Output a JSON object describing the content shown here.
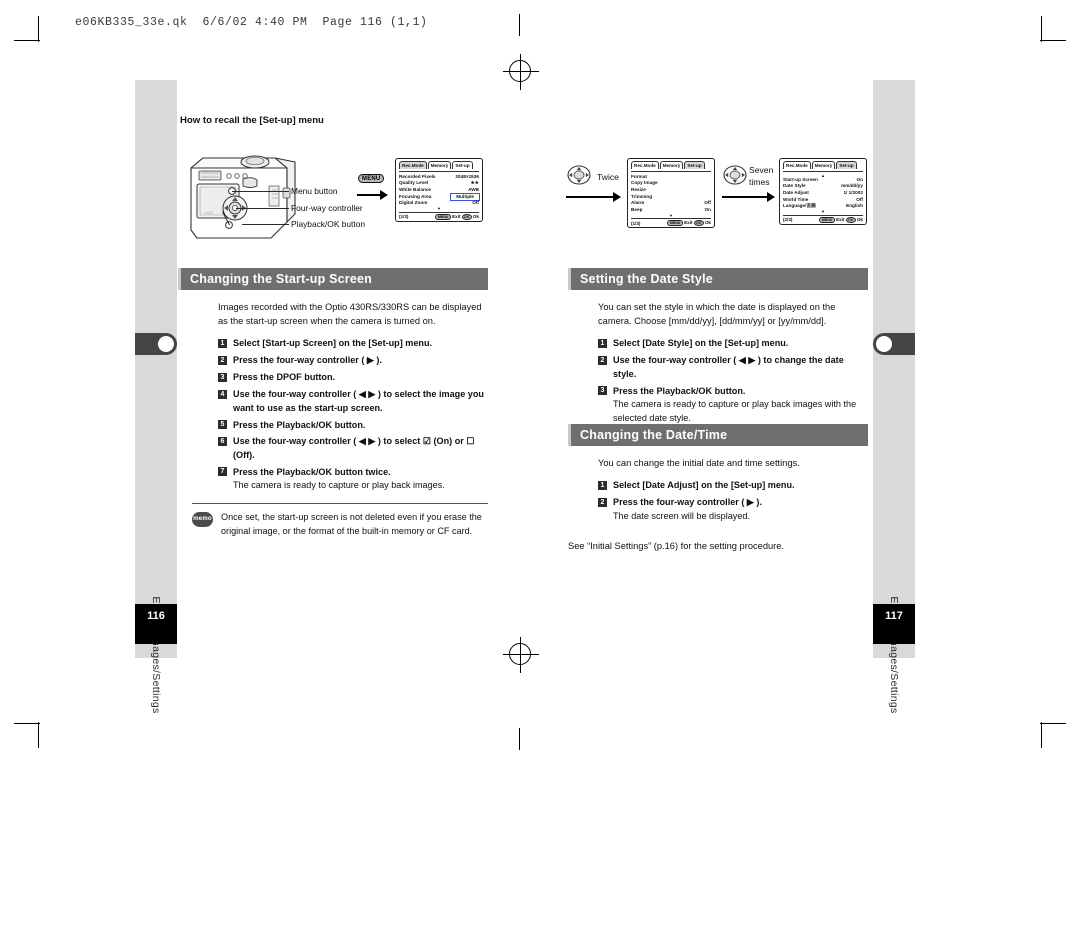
{
  "slug": "e06KB335_33e.qk  6/6/02 4:40 PM  Page 116 (1,1)",
  "sidebar": {
    "left_label": "Editing Images/Settings",
    "right_label": "Editing Images/Settings",
    "left_page": "116",
    "right_page": "117"
  },
  "howto": {
    "title": "How to recall the [Set-up] menu",
    "callouts": [
      "Menu button",
      "Four-way controller",
      "Playback/OK button"
    ],
    "menu_key": "MENU",
    "twice_label": "Twice",
    "seven_label_1": "Seven",
    "seven_label_2": "times"
  },
  "lcd1": {
    "tabs": [
      {
        "label": "Rec.Mode",
        "active": true
      },
      {
        "label": "Memory",
        "active": false
      },
      {
        "label": "Set-up",
        "active": false
      }
    ],
    "rows": [
      {
        "label": "Recorded Pixels",
        "value": "2048×1536",
        "highlight": false
      },
      {
        "label": "Quality Level",
        "value": "★★",
        "highlight": false
      },
      {
        "label": "White Balance",
        "value": "AWB",
        "highlight": false
      },
      {
        "label": "Focusing Area",
        "value": "Multiple",
        "highlight": true
      },
      {
        "label": "Digital Zoom",
        "value": "Off",
        "highlight": false
      }
    ],
    "page": "(1/3)",
    "exit": "Exit",
    "ok": "Ok",
    "menu_key": "MENU",
    "ok_key": "OK"
  },
  "lcd2": {
    "tabs": [
      {
        "label": "Rec.Mode",
        "active": false
      },
      {
        "label": "Memory",
        "active": false
      },
      {
        "label": "Set-up",
        "active": true
      }
    ],
    "rows": [
      {
        "label": "Format",
        "value": "",
        "highlight": false
      },
      {
        "label": "Copy Image",
        "value": "",
        "highlight": false
      },
      {
        "label": "Resize",
        "value": "",
        "highlight": false
      },
      {
        "label": "Trimming",
        "value": "",
        "highlight": false
      },
      {
        "label": "Alarm",
        "value": "Off",
        "highlight": false
      },
      {
        "label": "Beep",
        "value": "On",
        "highlight": false
      }
    ],
    "page": "(1/3)",
    "exit": "Exit",
    "ok": "Ok",
    "menu_key": "MENU",
    "ok_key": "OK"
  },
  "lcd3": {
    "tabs": [
      {
        "label": "Rec.Mode",
        "active": false
      },
      {
        "label": "Memory",
        "active": false
      },
      {
        "label": "Set-up",
        "active": true
      }
    ],
    "rows": [
      {
        "label": "Start-up Screen",
        "value": "On",
        "highlight": false
      },
      {
        "label": "Date Style",
        "value": "mm/dd/yy",
        "highlight": false
      },
      {
        "label": "Date Adjust",
        "value": "1/ 1/2002",
        "highlight": false
      },
      {
        "label": "World Time",
        "value": "Off",
        "highlight": false
      },
      {
        "label": "Language/言語",
        "value": "English",
        "highlight": false
      }
    ],
    "page": "(2/3)",
    "exit": "Exit",
    "ok": "Ok",
    "menu_key": "MENU",
    "ok_key": "OK"
  },
  "section_startup": {
    "title": "Changing the Start-up Screen",
    "intro": "Images recorded with the Optio 430RS/330RS can be displayed as the start-up screen when the camera is turned on.",
    "steps": [
      {
        "n": "1",
        "text": "Select [Start-up Screen] on the [Set-up] menu.",
        "sub": ""
      },
      {
        "n": "2",
        "text": "Press the four-way controller ( ▶ ).",
        "sub": ""
      },
      {
        "n": "3",
        "text": "Press the DPOF button.",
        "sub": ""
      },
      {
        "n": "4",
        "text": "Use the four-way controller ( ◀  ▶ ) to select the image you want to use as the start-up screen.",
        "sub": ""
      },
      {
        "n": "5",
        "text": "Press the Playback/OK button.",
        "sub": ""
      },
      {
        "n": "6",
        "text": "Use the four-way controller ( ◀  ▶ ) to select ☑ (On) or ☐ (Off).",
        "sub": ""
      },
      {
        "n": "7",
        "text": "Press the Playback/OK button twice.",
        "sub": "The camera is ready to capture or play back images."
      }
    ],
    "memo_badge": "memo",
    "memo": "Once set, the start-up screen is not deleted even if you erase the original image, or the format of the built-in memory or CF card."
  },
  "section_datestyle": {
    "title": "Setting the Date Style",
    "intro": "You can set the style in which the date is displayed on the camera. Choose [mm/dd/yy], [dd/mm/yy] or [yy/mm/dd].",
    "steps": [
      {
        "n": "1",
        "text": "Select [Date Style] on the [Set-up] menu.",
        "sub": ""
      },
      {
        "n": "2",
        "text": "Use the four-way controller ( ◀  ▶ ) to change the date style.",
        "sub": ""
      },
      {
        "n": "3",
        "text": "Press the Playback/OK button.",
        "sub": "The camera is ready to capture or play back images with the selected date style."
      }
    ]
  },
  "section_datetime": {
    "title": "Changing the Date/Time",
    "intro": "You can change the initial date and time settings.",
    "steps": [
      {
        "n": "1",
        "text": "Select [Date Adjust] on the [Set-up] menu.",
        "sub": ""
      },
      {
        "n": "2",
        "text": "Press the four-way controller ( ▶ ).",
        "sub": "The date screen will be displayed."
      }
    ],
    "footnote": "See “Initial Settings” (p.16) for the setting procedure."
  }
}
